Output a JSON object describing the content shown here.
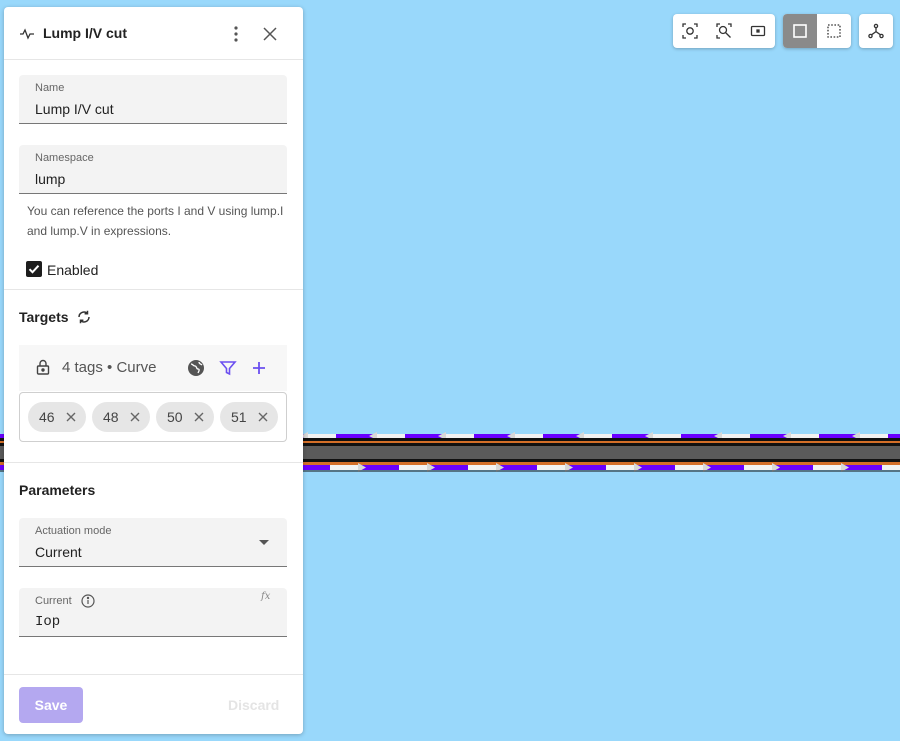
{
  "panel": {
    "title": "Lump I/V cut",
    "name_field": {
      "label": "Name",
      "value": "Lump I/V cut"
    },
    "namespace_field": {
      "label": "Namespace",
      "value": "lump"
    },
    "hint": "You can reference the ports I and V using lump.I and lump.V in expressions.",
    "enabled_label": "Enabled",
    "enabled_checked": true
  },
  "targets": {
    "title": "Targets",
    "summary": "4 tags • Curve",
    "chips": [
      "46",
      "48",
      "50",
      "51"
    ]
  },
  "parameters": {
    "title": "Parameters",
    "actuation": {
      "label": "Actuation mode",
      "value": "Current"
    },
    "current": {
      "label": "Current",
      "value": "Iop",
      "fx": "fx"
    }
  },
  "footer": {
    "save_label": "Save",
    "discard_label": "Discard"
  },
  "toolbar": {
    "icons": [
      "focus-target-icon",
      "zoom-fit-icon",
      "frame-icon",
      "select-box-icon",
      "dashed-select-icon",
      "fork-icon"
    ],
    "active": "select-box-icon"
  },
  "colors": {
    "canvas": "#99d8fb",
    "accent": "#6b4ff0",
    "wire_core": "#5a5a5a",
    "wire_stripe": "#6a00ff"
  }
}
